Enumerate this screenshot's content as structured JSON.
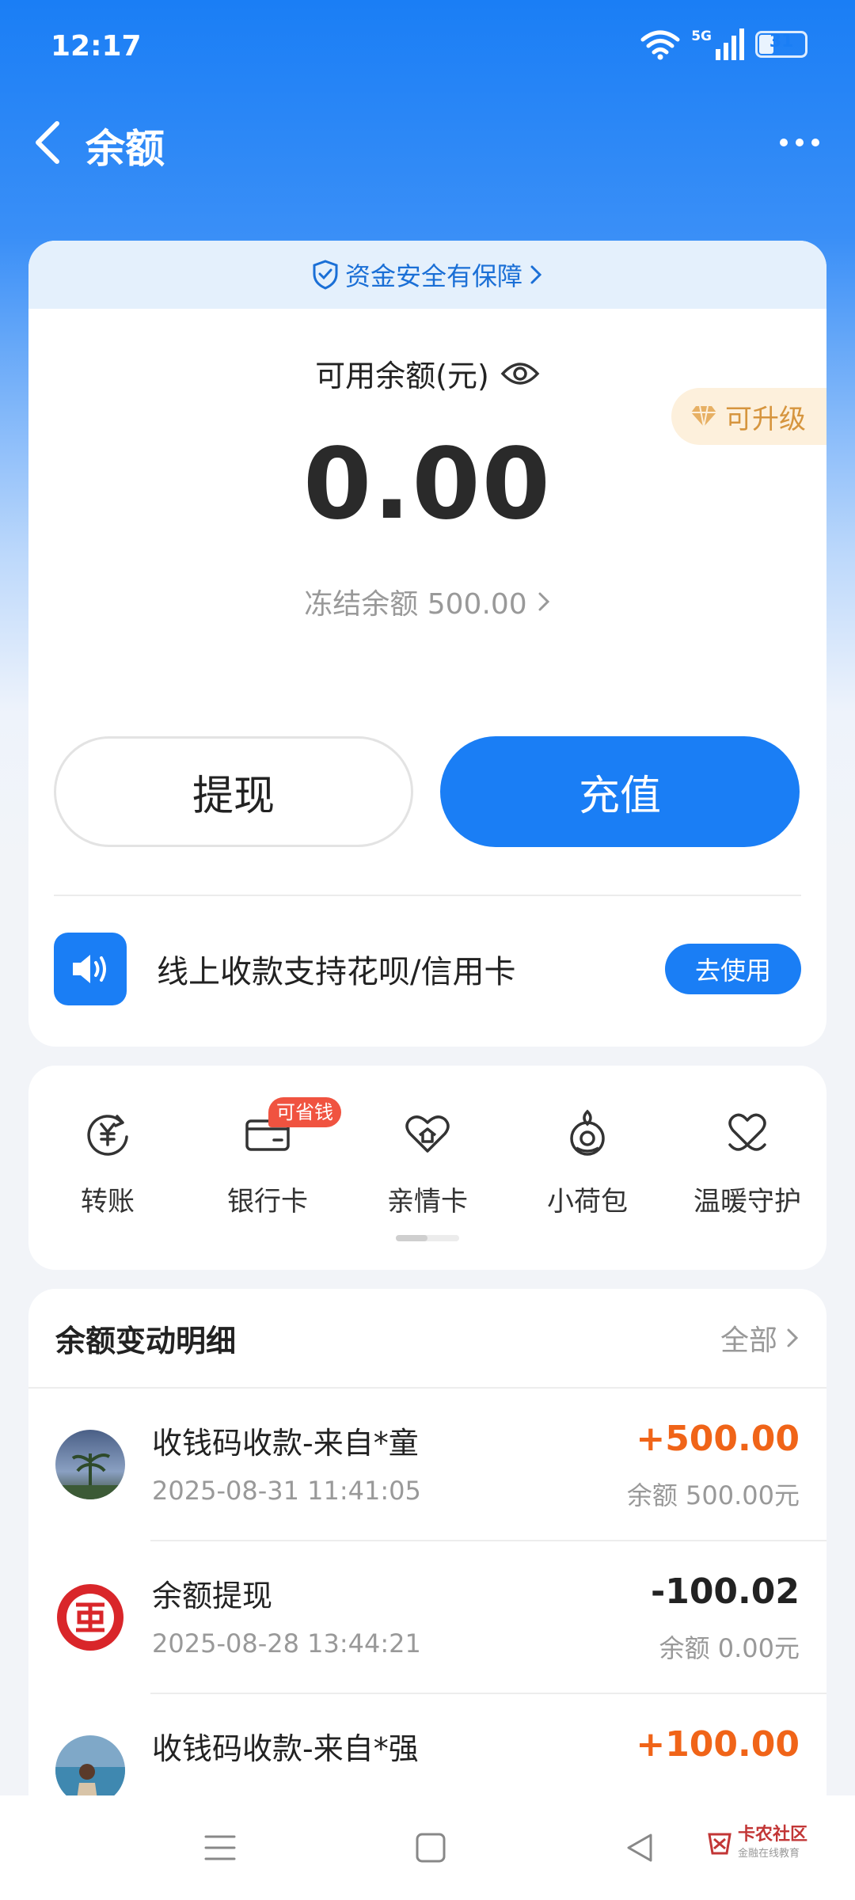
{
  "status_bar": {
    "time": "12:17",
    "network": "5G",
    "battery": "31"
  },
  "header": {
    "title": "余额"
  },
  "balance_card": {
    "safety_text": "资金安全有保障",
    "balance_label": "可用余额(元)",
    "upgrade_text": "可升级",
    "amount": "0.00",
    "frozen_text": "冻结余额 500.00",
    "withdraw_label": "提现",
    "recharge_label": "充值",
    "promo_text": "线上收款支持花呗/信用卡",
    "promo_button": "去使用"
  },
  "quick_actions": {
    "items": [
      {
        "label": "转账",
        "icon": "transfer-yen-icon"
      },
      {
        "label": "银行卡",
        "icon": "bank-card-icon"
      },
      {
        "label": "亲情卡",
        "icon": "family-card-heart-icon"
      },
      {
        "label": "小荷包",
        "icon": "lotus-purse-icon"
      },
      {
        "label": "温暖守护",
        "icon": "warm-guard-heart-icon"
      }
    ],
    "saving_tag": "可省钱"
  },
  "transactions": {
    "title": "余额变动明细",
    "filter_label": "全部",
    "rows": [
      {
        "name": "收钱码收款-来自*童",
        "time": "2025-08-31 11:41:05",
        "amount": "+500.00",
        "balance": "余额 500.00元"
      },
      {
        "name": "余额提现",
        "time": "2025-08-28 13:44:21",
        "amount": "-100.02",
        "balance": "余额 0.00元"
      },
      {
        "name": "收钱码收款-来自*强",
        "time": "",
        "amount": "+100.00",
        "balance": ""
      }
    ]
  },
  "watermark": {
    "text": "卡农社区",
    "sub": "金融在线教育"
  },
  "colors": {
    "primary": "#1a7ef5",
    "positive": "#f06418",
    "upgrade": "#d6953e",
    "tag": "#f05340"
  }
}
